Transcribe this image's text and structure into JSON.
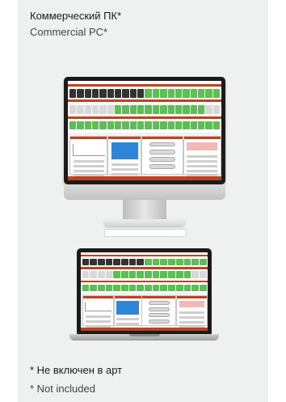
{
  "heading": {
    "title_ru": "Коммерческий ПК*",
    "title_en": "Commercial PC*"
  },
  "footnote": {
    "note_ru": "* Не включен в арт",
    "note_en": "* Not included"
  },
  "devices": [
    {
      "name": "desktop-monitor",
      "icon": "monitor-icon"
    },
    {
      "name": "laptop",
      "icon": "laptop-icon"
    }
  ],
  "colors": {
    "panel_background": "#eff0f0",
    "screen_accent_orange": "#c0411d",
    "channel_green": "#5cbf56",
    "channel_dark": "#333333",
    "chart_blue": "#2f86d6"
  }
}
